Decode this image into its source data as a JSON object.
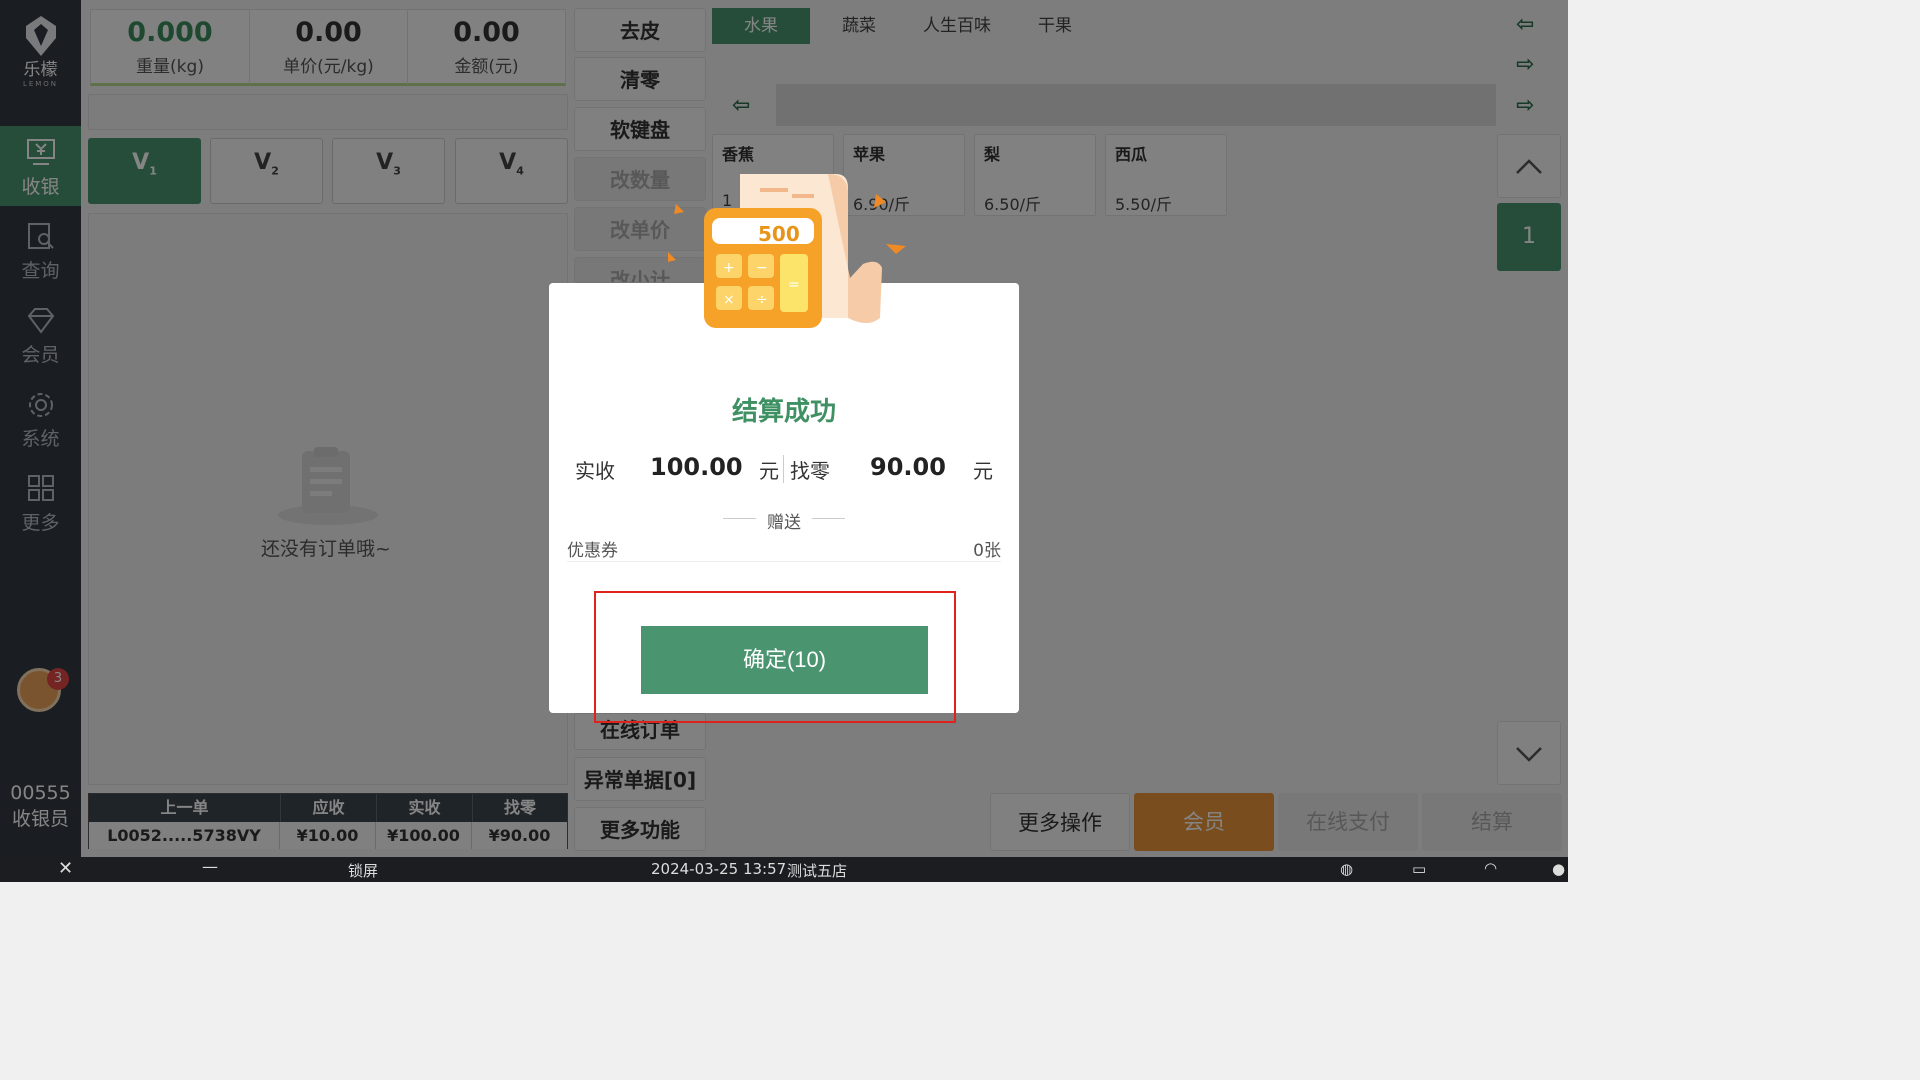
{
  "sidebar": {
    "logo_text": "乐檬",
    "logo_sub": "LEMON",
    "items": [
      {
        "label": "收银"
      },
      {
        "label": "查询"
      },
      {
        "label": "会员"
      },
      {
        "label": "系统"
      },
      {
        "label": "更多"
      }
    ],
    "notification_count": "3",
    "cashier_id": "00555",
    "cashier_role": "收银员"
  },
  "scale": {
    "weight_value": "0.000",
    "weight_label": "重量(kg)",
    "unit_price_value": "0.00",
    "unit_price_label": "单价(元/kg)",
    "amount_value": "0.00",
    "amount_label": "金额(元)"
  },
  "vtabs": [
    "V",
    "V",
    "V",
    "V"
  ],
  "vtab_subs": [
    "1",
    "2",
    "3",
    "4"
  ],
  "order": {
    "empty_text": "还没有订单哦~"
  },
  "last_order": {
    "headers": [
      "上一单",
      "应收",
      "实收",
      "找零"
    ],
    "values": [
      "L0052.....5738VY",
      "¥10.00",
      "¥100.00",
      "¥90.00"
    ]
  },
  "actions": {
    "tare": "去皮",
    "clear": "清零",
    "keyboard": "软键盘",
    "change_qty": "改数量",
    "change_price": "改单价",
    "change_subtotal": "改小计",
    "online_order": "在线订单",
    "abnormal": "异常单据[0]",
    "more_func": "更多功能"
  },
  "categories": [
    "水果",
    "蔬菜",
    "人生百味",
    "干果"
  ],
  "products": [
    {
      "name": "香蕉",
      "price": "1"
    },
    {
      "name": "苹果",
      "price": "6.90/斤"
    },
    {
      "name": "梨",
      "price": "6.50/斤"
    },
    {
      "name": "西瓜",
      "price": "5.50/斤"
    }
  ],
  "pager": {
    "page": "1"
  },
  "bottom": {
    "more_ops": "更多操作",
    "member": "会员",
    "online_pay": "在线支付",
    "checkout": "结算"
  },
  "status": {
    "lock": "锁屏",
    "datetime": "2024-03-25 13:57",
    "store": "测试五店"
  },
  "modal": {
    "illustration_number": "500",
    "title": "结算成功",
    "received_label": "实收",
    "received_value": "100.00",
    "received_unit": "元",
    "change_label": "找零",
    "change_value": "90.00",
    "change_unit": "元",
    "gift_label": "赠送",
    "coupon_label": "优惠券",
    "coupon_value": "0张",
    "confirm": "确定(10)"
  },
  "colors": {
    "accent": "#4a9570",
    "member": "#e8943a",
    "highlight": "#e0221c"
  }
}
